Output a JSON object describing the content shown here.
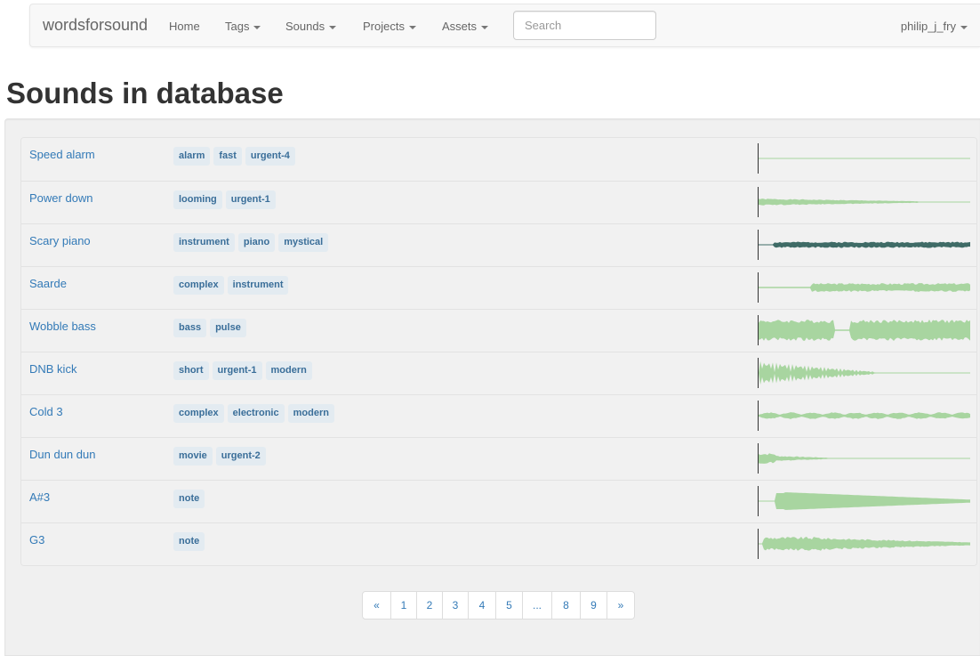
{
  "navbar": {
    "brand": "wordsforsound",
    "links": [
      "Home",
      "Tags",
      "Sounds",
      "Projects",
      "Assets"
    ],
    "search_placeholder": "Search",
    "user": "philip_j_fry"
  },
  "page_title": "Sounds in database",
  "sounds": [
    {
      "name": "Speed alarm",
      "tags": [
        "alarm",
        "fast",
        "urgent-4"
      ],
      "wave": "flat"
    },
    {
      "name": "Power down",
      "tags": [
        "looming",
        "urgent-1"
      ],
      "wave": "decay"
    },
    {
      "name": "Scary piano",
      "tags": [
        "instrument",
        "piano",
        "mystical"
      ],
      "wave": "dark"
    },
    {
      "name": "Saarde",
      "tags": [
        "complex",
        "instrument"
      ],
      "wave": "grow"
    },
    {
      "name": "Wobble bass",
      "tags": [
        "bass",
        "pulse"
      ],
      "wave": "wobble"
    },
    {
      "name": "DNB kick",
      "tags": [
        "short",
        "urgent-1",
        "modern"
      ],
      "wave": "kick"
    },
    {
      "name": "Cold 3",
      "tags": [
        "complex",
        "electronic",
        "modern"
      ],
      "wave": "beads"
    },
    {
      "name": "Dun dun dun",
      "tags": [
        "movie",
        "urgent-2"
      ],
      "wave": "short"
    },
    {
      "name": "A#3",
      "tags": [
        "note"
      ],
      "wave": "note"
    },
    {
      "name": "G3",
      "tags": [
        "note"
      ],
      "wave": "note2"
    }
  ],
  "pagination": [
    "«",
    "1",
    "2",
    "3",
    "4",
    "5",
    "...",
    "8",
    "9",
    "»"
  ],
  "colors": {
    "wave": "#a8d5a0",
    "wave_dark": "#3f6b66",
    "link": "#337ab7",
    "tag_bg": "#e3ebf1"
  }
}
